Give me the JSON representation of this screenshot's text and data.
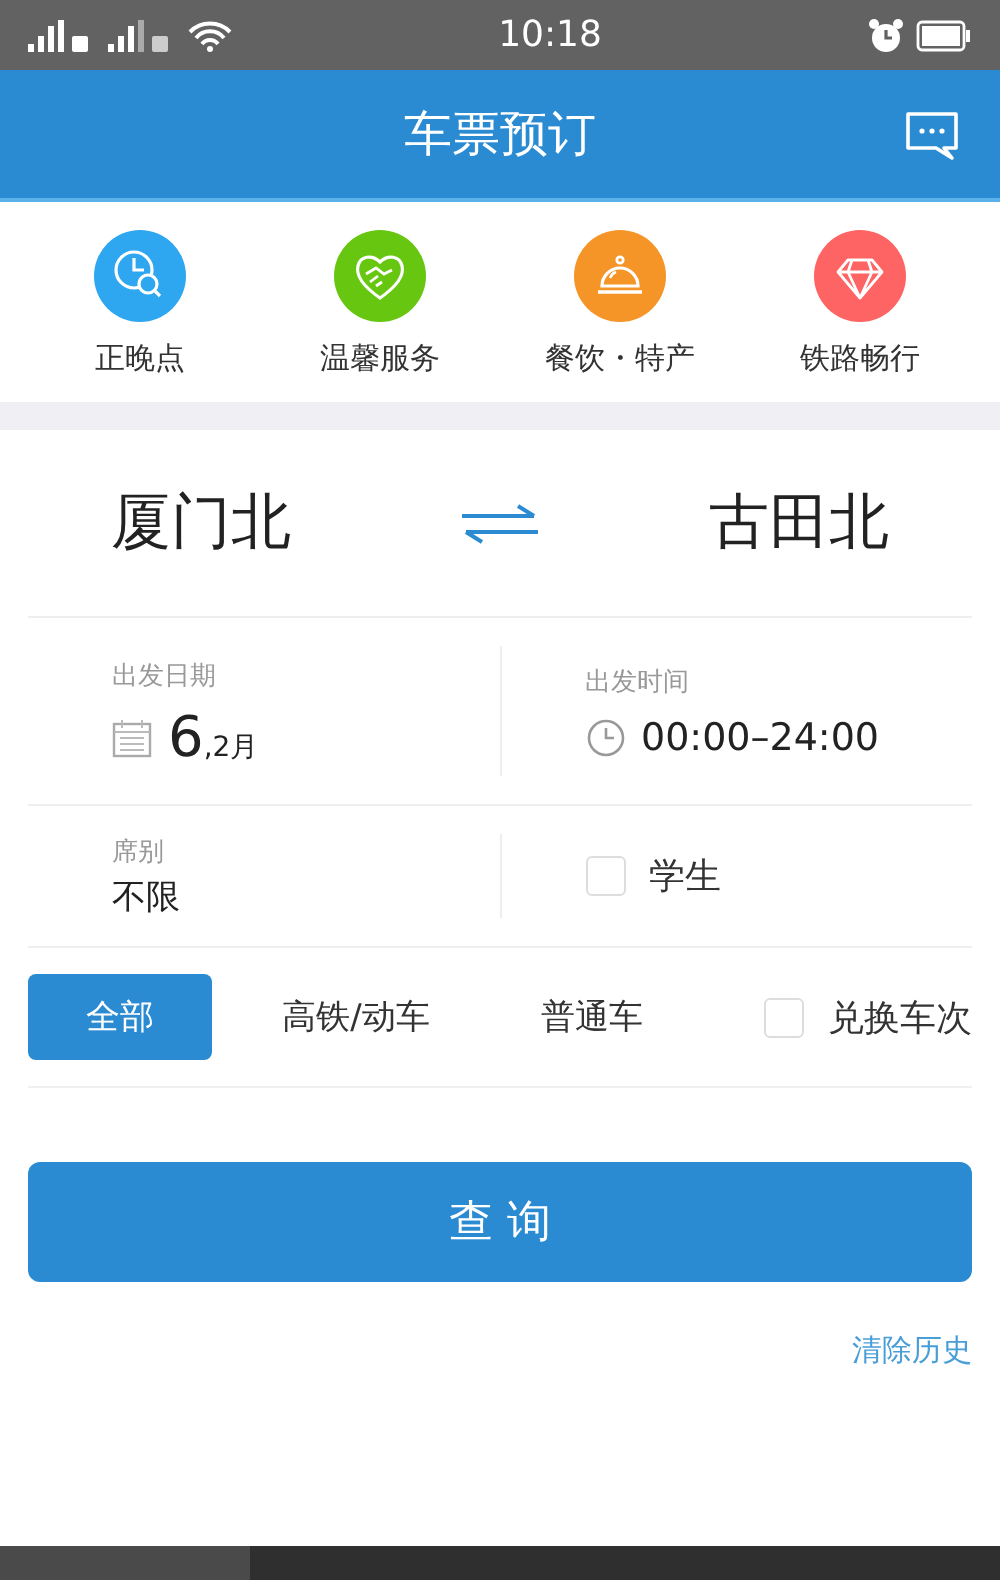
{
  "status_bar": {
    "time": "10:18"
  },
  "header": {
    "title": "车票预订"
  },
  "shortcuts": [
    {
      "label": "正晚点",
      "color": "#2ea6f0",
      "kind": "clock"
    },
    {
      "label": "温馨服务",
      "color": "#66c610",
      "kind": "heart"
    },
    {
      "label": "餐饮・特产",
      "color": "#f59527",
      "kind": "cloche"
    },
    {
      "label": "铁路畅行",
      "color": "#fd6463",
      "kind": "diamond"
    }
  ],
  "route": {
    "from": "厦门北",
    "to": "古田北"
  },
  "date": {
    "label": "出发日期",
    "day": "6",
    "month": ",2月"
  },
  "time": {
    "label": "出发时间",
    "value": "00:00–24:00"
  },
  "seat": {
    "label": "席别",
    "value": "不限"
  },
  "student": {
    "label": "学生",
    "checked": false
  },
  "train_types": [
    {
      "label": "全部",
      "selected": true
    },
    {
      "label": "高铁/动车",
      "selected": false
    },
    {
      "label": "普通车",
      "selected": false
    }
  ],
  "swap_trains": {
    "label": "兑换车次",
    "checked": false
  },
  "query_button": "查 询",
  "clear_history": "清除历史"
}
